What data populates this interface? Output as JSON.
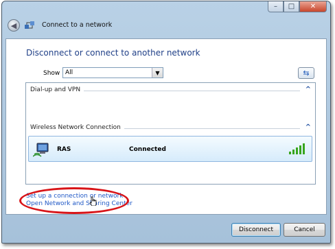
{
  "window": {
    "title": "Connect to a network",
    "controls": {
      "minimize": "–",
      "maximize": "□",
      "close": "✕"
    }
  },
  "main": {
    "heading": "Disconnect or connect to another network",
    "show_label": "Show",
    "show_value": "All",
    "refresh_icon": "refresh-arrows-icon"
  },
  "groups": [
    {
      "label": "Dial-up and VPN",
      "expanded": true
    },
    {
      "label": "Wireless Network Connection",
      "expanded": true
    }
  ],
  "network": {
    "name": "RAS",
    "status": "Connected",
    "signal_bars": 5
  },
  "links": {
    "setup": "Set up a connection or network",
    "sharing": "Open Network and Sharing Center"
  },
  "buttons": {
    "disconnect": "Disconnect",
    "cancel": "Cancel"
  },
  "colors": {
    "accent": "#1f3f87",
    "link": "#1f58c6",
    "highlight": "#d81418",
    "signal": "#37a51d"
  }
}
